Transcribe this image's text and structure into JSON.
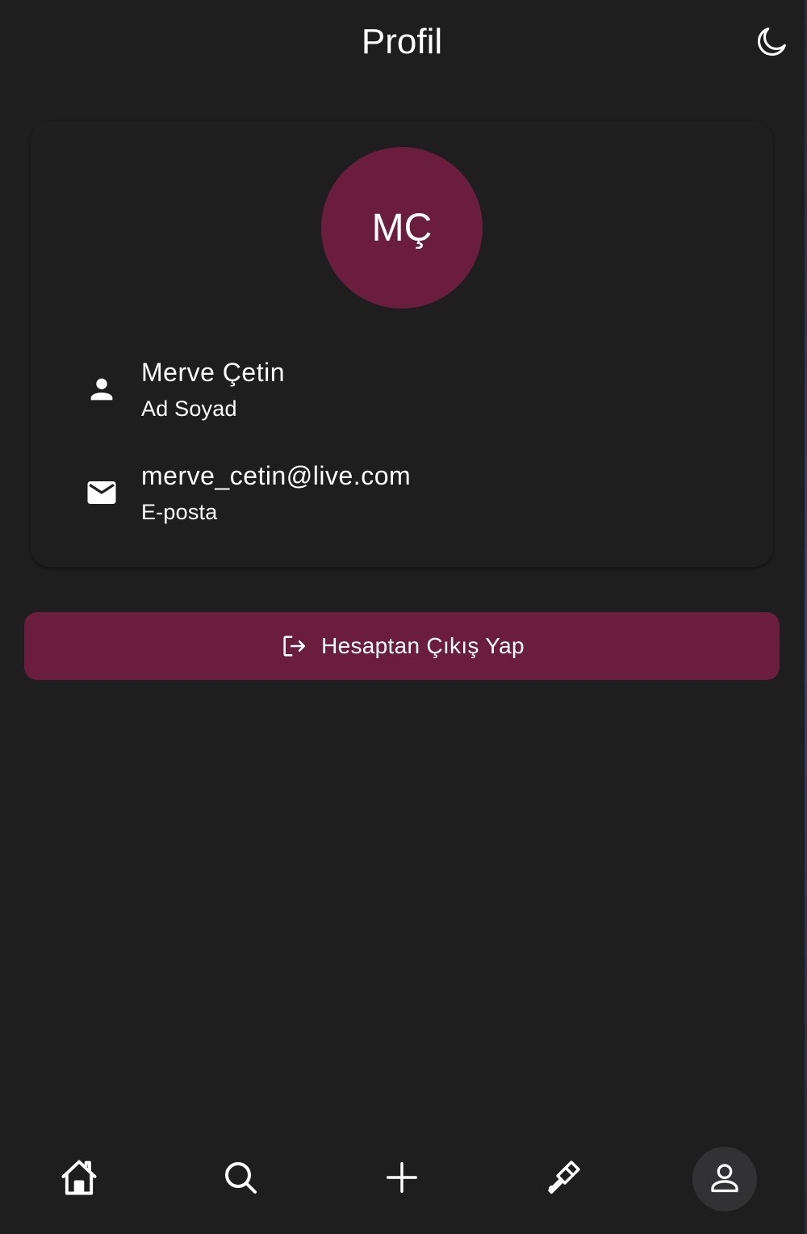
{
  "app_bar": {
    "title": "Profil",
    "theme_toggle_icon": "moon-icon"
  },
  "profile": {
    "initials": "MÇ",
    "avatar_color": "#6a1d3d",
    "name": {
      "value": "Merve Çetin",
      "label": "Ad Soyad",
      "icon": "person-icon"
    },
    "email": {
      "value": "merve_cetin@live.com",
      "label": "E-posta",
      "icon": "mail-icon"
    }
  },
  "logout_button": {
    "label": "Hesaptan Çıkış Yap",
    "icon": "logout-icon",
    "color": "#6a1d3d"
  },
  "bottom_nav": {
    "items": [
      {
        "icon": "home-icon",
        "active": false
      },
      {
        "icon": "search-icon",
        "active": false
      },
      {
        "icon": "add-icon",
        "active": false
      },
      {
        "icon": "brush-icon",
        "active": false
      },
      {
        "icon": "profile-icon",
        "active": true
      }
    ]
  },
  "colors": {
    "background": "#1e1e1f",
    "accent": "#6a1d3d",
    "text": "#ffffff"
  }
}
